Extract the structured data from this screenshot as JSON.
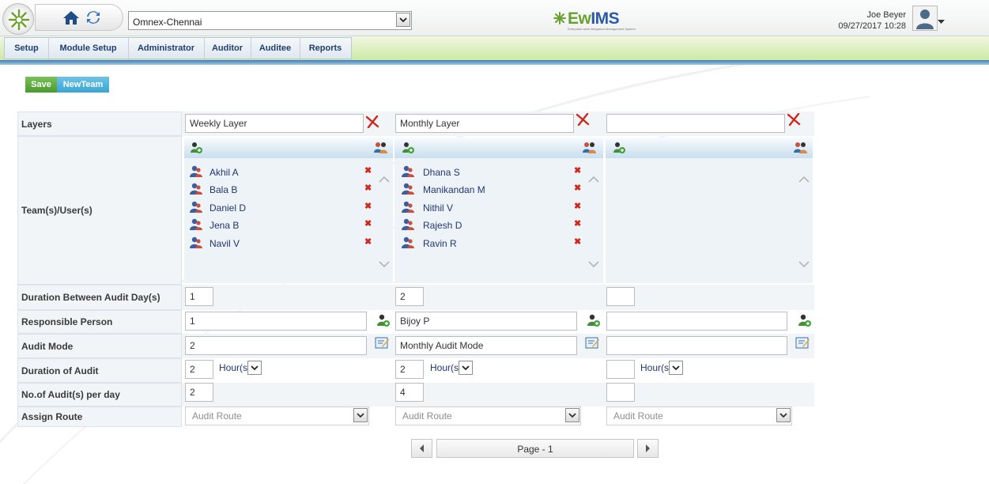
{
  "header": {
    "site": "Omnex-Chennai",
    "brand_main": "Ew",
    "brand_accent": "IMS",
    "brand_tagline": "Enterprise-wide Integrated Management System",
    "user_name": "Joe Beyer",
    "datetime": "09/27/2017 10:28"
  },
  "menu": {
    "items": [
      "Setup",
      "Module Setup",
      "Administrator",
      "Auditor",
      "Auditee",
      "Reports"
    ]
  },
  "toolbar": {
    "save_label": "Save",
    "newteam_label": "NewTeam"
  },
  "labels": {
    "layers": "Layers",
    "team_users": "Team(s)/User(s)",
    "duration_between": "Duration Between Audit Day(s)",
    "responsible": "Responsible Person",
    "audit_mode": "Audit Mode",
    "duration_audit": "Duration of Audit",
    "audits_per_day": "No.of Audit(s) per day",
    "assign_route": "Assign Route"
  },
  "layers": [
    {
      "name": "Weekly Layer",
      "users": [
        "Akhil A",
        "Bala B",
        "Daniel D",
        "Jena B",
        "Navil V"
      ],
      "duration_between": "1",
      "responsible": "1",
      "audit_mode": "2",
      "duration": "2",
      "duration_unit": "Hour(s)",
      "audits_per_day": "2",
      "route_placeholder": "Audit Route"
    },
    {
      "name": "Monthly Layer",
      "users": [
        "Dhana S",
        "Manikandan M",
        "Nithil V",
        "Rajesh D",
        "Ravin R"
      ],
      "duration_between": "2",
      "responsible": "Bijoy P",
      "audit_mode": "Monthly Audit Mode",
      "duration": "2",
      "duration_unit": "Hour(s)",
      "audits_per_day": "4",
      "route_placeholder": "Audit Route"
    },
    {
      "name": "",
      "users": [],
      "duration_between": "",
      "responsible": "",
      "audit_mode": "",
      "duration": "",
      "duration_unit": "Hour(s)",
      "audits_per_day": "",
      "route_placeholder": "Audit Route"
    }
  ],
  "pager": {
    "label": "Page - 1"
  },
  "colors": {
    "menu_green": "#cde9a3",
    "blue_strip": "#3c7fb6",
    "save_green": "#4b9a2f",
    "newteam_blue": "#3aa5d1",
    "remove_red": "#d0271d"
  }
}
